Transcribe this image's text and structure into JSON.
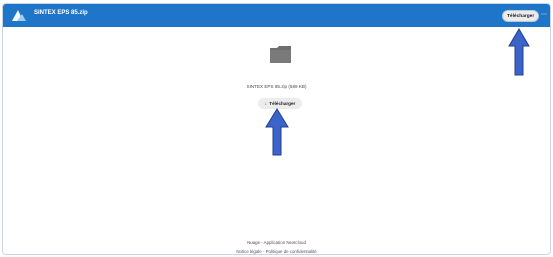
{
  "header": {
    "filename": "SINTEX EPS 85.zip",
    "download_label": "Télécharger",
    "more_label": "⋯"
  },
  "file": {
    "meta": "SINTEX EPS 85.zip (589 KB)",
    "download_label": "Télécharger",
    "download_icon": "↓"
  },
  "footer": {
    "line1": "Nuage - Application Nextcloud",
    "line2": "Notice légale - Politique de confidentialité"
  },
  "colors": {
    "brand": "#1f76c9",
    "annotation_arrow": "#3b63c8"
  },
  "icons": [
    "logo-icon",
    "file-icon",
    "download-icon",
    "more-icon",
    "annotation-arrow-icon"
  ]
}
